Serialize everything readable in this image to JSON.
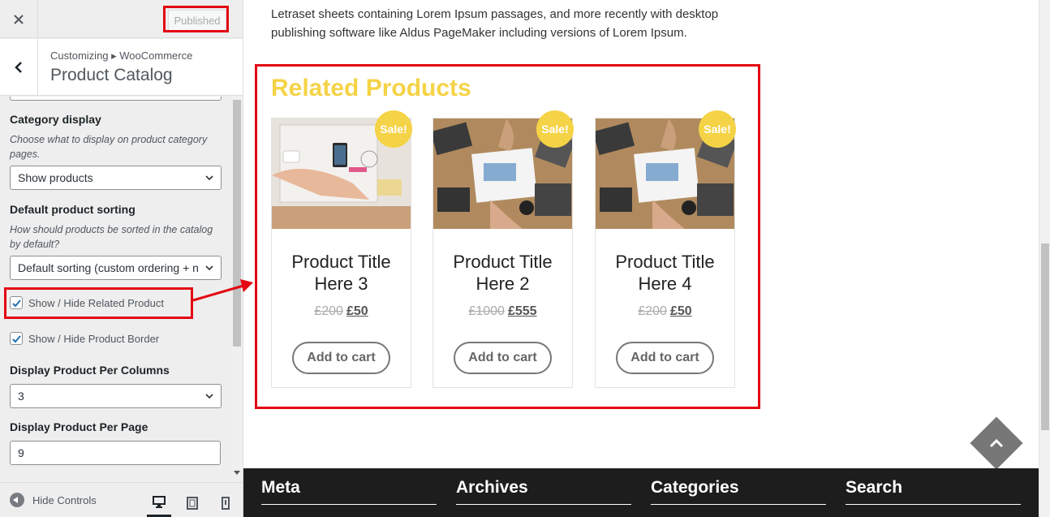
{
  "sidebar": {
    "close_icon": "close-icon",
    "publish_label": "Published",
    "breadcrumb": "Customizing ▸ WooCommerce",
    "section_title": "Product Catalog",
    "category_display": {
      "title": "Category display",
      "description": "Choose what to display on product category pages.",
      "value": "Show products"
    },
    "default_sorting": {
      "title": "Default product sorting",
      "description": "How should products be sorted in the catalog by default?",
      "value": "Default sorting (custom ordering + n"
    },
    "show_related": {
      "label": "Show / Hide Related Product",
      "checked": true
    },
    "show_border": {
      "label": "Show / Hide Product Border",
      "checked": true
    },
    "per_columns": {
      "title": "Display Product Per Columns",
      "value": "3"
    },
    "per_page": {
      "title": "Display Product Per Page",
      "value": "9"
    },
    "footer": {
      "hide_controls": "Hide Controls"
    }
  },
  "preview": {
    "paragraph": "Letraset sheets containing Lorem Ipsum passages, and more recently with desktop publishing software like Aldus PageMaker including versions of Lorem Ipsum.",
    "related_title": "Related Products",
    "products": [
      {
        "sale": "Sale!",
        "title": "Product Title Here 3",
        "old_price": "£200",
        "new_price": "£50",
        "button": "Add to cart"
      },
      {
        "sale": "Sale!",
        "title": "Product Title Here 2",
        "old_price": "£1000",
        "new_price": "£555",
        "button": "Add to cart"
      },
      {
        "sale": "Sale!",
        "title": "Product Title Here 4",
        "old_price": "£200",
        "new_price": "£50",
        "button": "Add to cart"
      }
    ],
    "footer_widgets": [
      "Meta",
      "Archives",
      "Categories",
      "Search"
    ]
  },
  "colors": {
    "accent": "#f5d346",
    "annotation": "#e30613",
    "footer_bg": "#1d1d1d"
  }
}
